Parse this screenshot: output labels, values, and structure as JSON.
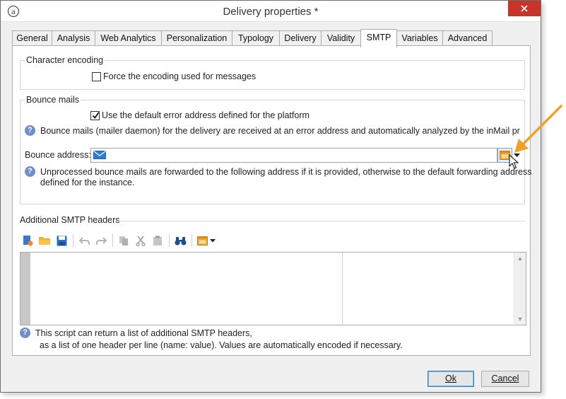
{
  "window": {
    "title": "Delivery properties *"
  },
  "tabs": [
    {
      "label": "General",
      "active": false
    },
    {
      "label": "Analysis",
      "active": false
    },
    {
      "label": "Web Analytics",
      "active": false
    },
    {
      "label": "Personalization",
      "active": false
    },
    {
      "label": "Typology",
      "active": false
    },
    {
      "label": "Delivery",
      "active": false
    },
    {
      "label": "Validity",
      "active": false
    },
    {
      "label": "SMTP",
      "active": true
    },
    {
      "label": "Variables",
      "active": false
    },
    {
      "label": "Advanced",
      "active": false
    }
  ],
  "character_encoding": {
    "label": "Character encoding",
    "force_checkbox_label": "Force the encoding used for messages",
    "force_checked": false
  },
  "bounce": {
    "label": "Bounce mails",
    "default_checkbox_label": "Use the default error address defined for the platform",
    "default_checked": true,
    "help_text": "Bounce mails (mailer daemon) for the delivery are received at an error address and automatically analyzed by the inMail pr",
    "address_label": "Bounce address:",
    "address_value": "",
    "unprocessed_help_line1": "Unprocessed bounce mails are forwarded to the following address if it is provided, otherwise to the default forwarding address",
    "unprocessed_help_line2": "defined for the instance."
  },
  "smtp_headers": {
    "label": "Additional SMTP headers",
    "help_line1": "This script can return a list of additional SMTP headers,",
    "help_line2": "as a list of one header per line (name: value). Values are automatically encoded if necessary."
  },
  "buttons": {
    "ok": "Ok",
    "cancel": "Cancel"
  },
  "colors": {
    "close": "#c7352a",
    "accent_arrow": "#f0a12b",
    "help": "#6f8fc8"
  }
}
